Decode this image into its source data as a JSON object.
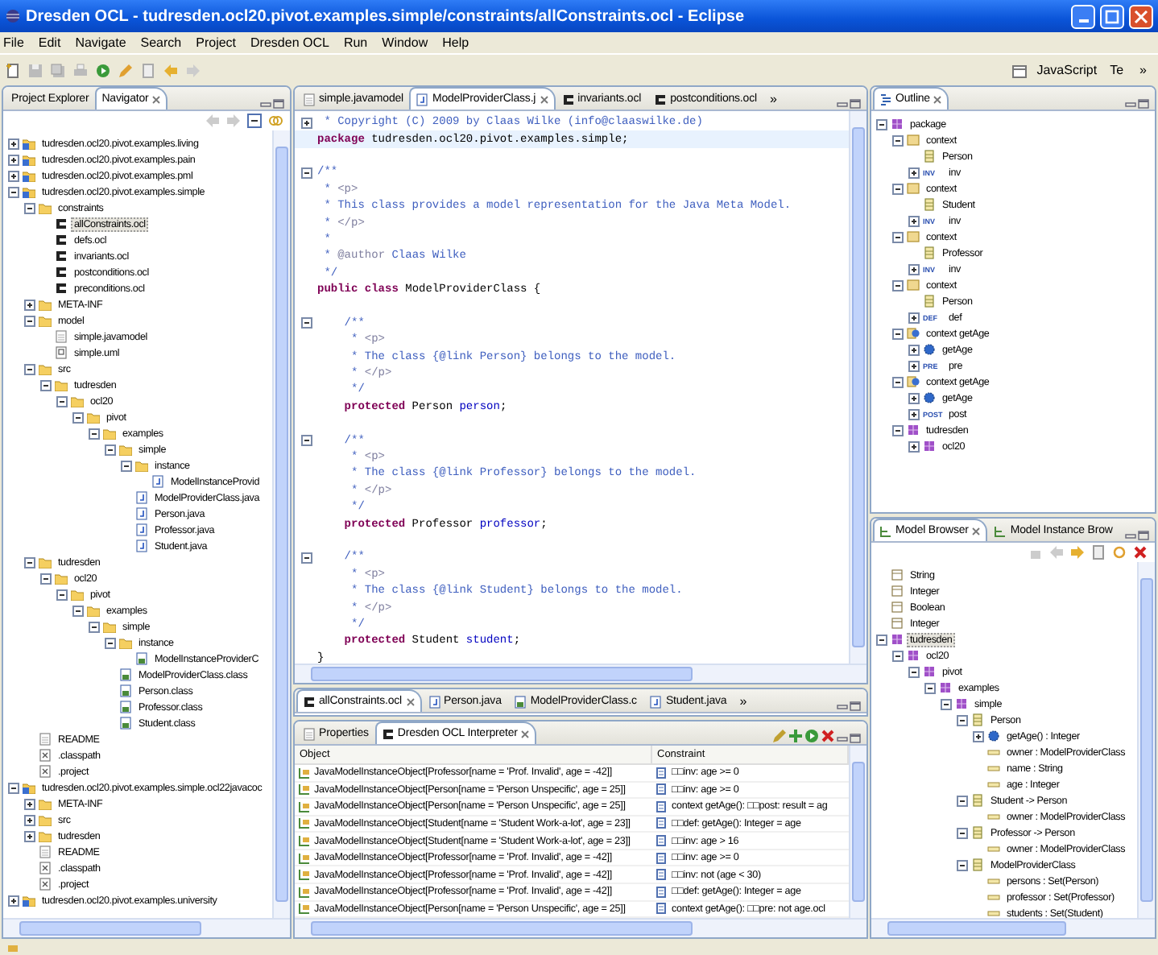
{
  "window": {
    "title": "Dresden OCL - tudresden.ocl20.pivot.examples.simple/constraints/allConstraints.ocl - Eclipse"
  },
  "menu": [
    "File",
    "Edit",
    "Navigate",
    "Search",
    "Project",
    "Dresden OCL",
    "Run",
    "Window",
    "Help"
  ],
  "toolbar": {
    "perspectives": [
      "JavaScript",
      "Te"
    ],
    "overflow": "»"
  },
  "navigator": {
    "tabs": [
      {
        "label": "Project Explorer",
        "selected": false
      },
      {
        "label": "Navigator",
        "selected": true
      }
    ],
    "tree": [
      {
        "label": "tudresden.ocl20.pivot.examples.living",
        "kind": "project",
        "expanded": false,
        "selected": false
      },
      {
        "label": "tudresden.ocl20.pivot.examples.pain",
        "kind": "project",
        "expanded": false,
        "selected": false
      },
      {
        "label": "tudresden.ocl20.pivot.examples.pml",
        "kind": "project",
        "expanded": false,
        "selected": false
      },
      {
        "label": "tudresden.ocl20.pivot.examples.simple",
        "kind": "project",
        "expanded": true,
        "selected": false,
        "children": [
          {
            "label": "constraints",
            "kind": "folder",
            "expanded": true,
            "selected": false,
            "children": [
              {
                "label": "allConstraints.ocl",
                "kind": "ocl",
                "selected": true
              },
              {
                "label": "defs.ocl",
                "kind": "ocl",
                "selected": false
              },
              {
                "label": "invariants.ocl",
                "kind": "ocl",
                "selected": false
              },
              {
                "label": "postconditions.ocl",
                "kind": "ocl",
                "selected": false
              },
              {
                "label": "preconditions.ocl",
                "kind": "ocl",
                "selected": false
              }
            ]
          },
          {
            "label": "META-INF",
            "kind": "folder",
            "expanded": false,
            "selected": false
          },
          {
            "label": "model",
            "kind": "folder",
            "expanded": true,
            "selected": false,
            "children": [
              {
                "label": "simple.javamodel",
                "kind": "file",
                "selected": false
              },
              {
                "label": "simple.uml",
                "kind": "uml",
                "selected": false
              }
            ]
          },
          {
            "label": "src",
            "kind": "folder",
            "expanded": true,
            "selected": false,
            "children": [
              {
                "label": "tudresden",
                "kind": "folder",
                "expanded": true,
                "selected": false,
                "children": [
                  {
                    "label": "ocl20",
                    "kind": "folder",
                    "expanded": true,
                    "selected": false,
                    "children": [
                      {
                        "label": "pivot",
                        "kind": "folder",
                        "expanded": true,
                        "selected": false,
                        "children": [
                          {
                            "label": "examples",
                            "kind": "folder",
                            "expanded": true,
                            "selected": false,
                            "children": [
                              {
                                "label": "simple",
                                "kind": "folder",
                                "expanded": true,
                                "selected": false,
                                "children": [
                                  {
                                    "label": "instance",
                                    "kind": "folder",
                                    "expanded": true,
                                    "selected": false,
                                    "children": [
                                      {
                                        "label": "ModelInstanceProvid",
                                        "kind": "java",
                                        "selected": false
                                      }
                                    ]
                                  },
                                  {
                                    "label": "ModelProviderClass.java",
                                    "kind": "java",
                                    "selected": false
                                  },
                                  {
                                    "label": "Person.java",
                                    "kind": "java",
                                    "selected": false
                                  },
                                  {
                                    "label": "Professor.java",
                                    "kind": "java",
                                    "selected": false
                                  },
                                  {
                                    "label": "Student.java",
                                    "kind": "java",
                                    "selected": false
                                  }
                                ]
                              }
                            ]
                          }
                        ]
                      }
                    ]
                  }
                ]
              }
            ]
          },
          {
            "label": "tudresden",
            "kind": "folder",
            "expanded": true,
            "selected": false,
            "children": [
              {
                "label": "ocl20",
                "kind": "folder",
                "expanded": true,
                "selected": false,
                "children": [
                  {
                    "label": "pivot",
                    "kind": "folder",
                    "expanded": true,
                    "selected": false,
                    "children": [
                      {
                        "label": "examples",
                        "kind": "folder",
                        "expanded": true,
                        "selected": false,
                        "children": [
                          {
                            "label": "simple",
                            "kind": "folder",
                            "expanded": true,
                            "selected": false,
                            "children": [
                              {
                                "label": "instance",
                                "kind": "folder",
                                "expanded": true,
                                "selected": false,
                                "children": [
                                  {
                                    "label": "ModelInstanceProviderC",
                                    "kind": "class",
                                    "selected": false
                                  }
                                ]
                              },
                              {
                                "label": "ModelProviderClass.class",
                                "kind": "class",
                                "selected": false
                              },
                              {
                                "label": "Person.class",
                                "kind": "class",
                                "selected": false
                              },
                              {
                                "label": "Professor.class",
                                "kind": "class",
                                "selected": false
                              },
                              {
                                "label": "Student.class",
                                "kind": "class",
                                "selected": false
                              }
                            ]
                          }
                        ]
                      }
                    ]
                  }
                ]
              }
            ]
          },
          {
            "label": "README",
            "kind": "file",
            "selected": false
          },
          {
            "label": ".classpath",
            "kind": "xml",
            "selected": false
          },
          {
            "label": ".project",
            "kind": "xml",
            "selected": false
          }
        ]
      },
      {
        "label": "tudresden.ocl20.pivot.examples.simple.ocl22javacoc",
        "kind": "project",
        "expanded": true,
        "selected": false,
        "children": [
          {
            "label": "META-INF",
            "kind": "folder",
            "expanded": false,
            "selected": false
          },
          {
            "label": "src",
            "kind": "folder",
            "expanded": false,
            "selected": false
          },
          {
            "label": "tudresden",
            "kind": "folder",
            "expanded": false,
            "selected": false
          },
          {
            "label": "README",
            "kind": "file",
            "selected": false
          },
          {
            "label": ".classpath",
            "kind": "xml",
            "selected": false
          },
          {
            "label": ".project",
            "kind": "xml",
            "selected": false
          }
        ]
      },
      {
        "label": "tudresden.ocl20.pivot.examples.university",
        "kind": "project",
        "expanded": false,
        "selected": false
      }
    ]
  },
  "editor": {
    "tabs": [
      {
        "label": "simple.javamodel",
        "kind": "file",
        "selected": false
      },
      {
        "label": "ModelProviderClass.j",
        "kind": "java",
        "selected": true
      },
      {
        "label": "invariants.ocl",
        "kind": "ocl",
        "selected": false
      },
      {
        "label": "postconditions.ocl",
        "kind": "ocl",
        "selected": false
      }
    ],
    "overflow": "»",
    "lines": [
      {
        "kind": "code",
        "folded": true,
        "segments": [
          {
            "kind": "comment",
            "text": " * Copyright (C) 2009 by Claas Wilke (info@claaswilke.de)"
          }
        ]
      },
      {
        "kind": "code",
        "current": true,
        "segments": [
          {
            "kind": "keyword",
            "text": "package"
          },
          {
            "kind": "plain",
            "text": " tudresden.ocl20.pivot.examples.simple;"
          }
        ]
      },
      {
        "kind": "blank"
      },
      {
        "kind": "code",
        "folded": false,
        "segments": [
          {
            "kind": "comment",
            "text": "/**"
          }
        ]
      },
      {
        "kind": "code",
        "segments": [
          {
            "kind": "comment",
            "text": " * "
          },
          {
            "kind": "tag",
            "text": "<p>"
          }
        ]
      },
      {
        "kind": "code",
        "segments": [
          {
            "kind": "comment",
            "text": " * This class provides a model representation for the Java Meta Model."
          }
        ]
      },
      {
        "kind": "code",
        "segments": [
          {
            "kind": "comment",
            "text": " * "
          },
          {
            "kind": "tag",
            "text": "</p>"
          }
        ]
      },
      {
        "kind": "code",
        "segments": [
          {
            "kind": "comment",
            "text": " *"
          }
        ]
      },
      {
        "kind": "code",
        "segments": [
          {
            "kind": "comment",
            "text": " * "
          },
          {
            "kind": "tag",
            "text": "@author"
          },
          {
            "kind": "comment",
            "text": " Claas Wilke"
          }
        ]
      },
      {
        "kind": "code",
        "segments": [
          {
            "kind": "comment",
            "text": " */"
          }
        ]
      },
      {
        "kind": "code",
        "segments": [
          {
            "kind": "keyword",
            "text": "public class"
          },
          {
            "kind": "plain",
            "text": " ModelProviderClass {"
          }
        ]
      },
      {
        "kind": "blank"
      },
      {
        "kind": "code",
        "folded": false,
        "segments": [
          {
            "kind": "comment",
            "text": "    /**"
          }
        ]
      },
      {
        "kind": "code",
        "segments": [
          {
            "kind": "comment",
            "text": "     * "
          },
          {
            "kind": "tag",
            "text": "<p>"
          }
        ]
      },
      {
        "kind": "code",
        "segments": [
          {
            "kind": "comment",
            "text": "     * The class {@link Person} belongs to the model."
          }
        ]
      },
      {
        "kind": "code",
        "segments": [
          {
            "kind": "comment",
            "text": "     * "
          },
          {
            "kind": "tag",
            "text": "</p>"
          }
        ]
      },
      {
        "kind": "code",
        "segments": [
          {
            "kind": "comment",
            "text": "     */"
          }
        ]
      },
      {
        "kind": "code",
        "segments": [
          {
            "kind": "keyword",
            "text": "    protected"
          },
          {
            "kind": "plain",
            "text": " Person "
          },
          {
            "kind": "field",
            "text": "person"
          },
          {
            "kind": "plain",
            "text": ";"
          }
        ]
      },
      {
        "kind": "blank"
      },
      {
        "kind": "code",
        "folded": false,
        "segments": [
          {
            "kind": "comment",
            "text": "    /**"
          }
        ]
      },
      {
        "kind": "code",
        "segments": [
          {
            "kind": "comment",
            "text": "     * "
          },
          {
            "kind": "tag",
            "text": "<p>"
          }
        ]
      },
      {
        "kind": "code",
        "segments": [
          {
            "kind": "comment",
            "text": "     * The class {@link Professor} belongs to the model."
          }
        ]
      },
      {
        "kind": "code",
        "segments": [
          {
            "kind": "comment",
            "text": "     * "
          },
          {
            "kind": "tag",
            "text": "</p>"
          }
        ]
      },
      {
        "kind": "code",
        "segments": [
          {
            "kind": "comment",
            "text": "     */"
          }
        ]
      },
      {
        "kind": "code",
        "segments": [
          {
            "kind": "keyword",
            "text": "    protected"
          },
          {
            "kind": "plain",
            "text": " Professor "
          },
          {
            "kind": "field",
            "text": "professor"
          },
          {
            "kind": "plain",
            "text": ";"
          }
        ]
      },
      {
        "kind": "blank"
      },
      {
        "kind": "code",
        "folded": false,
        "segments": [
          {
            "kind": "comment",
            "text": "    /**"
          }
        ]
      },
      {
        "kind": "code",
        "segments": [
          {
            "kind": "comment",
            "text": "     * "
          },
          {
            "kind": "tag",
            "text": "<p>"
          }
        ]
      },
      {
        "kind": "code",
        "segments": [
          {
            "kind": "comment",
            "text": "     * The class {@link Student} belongs to the model."
          }
        ]
      },
      {
        "kind": "code",
        "segments": [
          {
            "kind": "comment",
            "text": "     * "
          },
          {
            "kind": "tag",
            "text": "</p>"
          }
        ]
      },
      {
        "kind": "code",
        "segments": [
          {
            "kind": "comment",
            "text": "     */"
          }
        ]
      },
      {
        "kind": "code",
        "segments": [
          {
            "kind": "keyword",
            "text": "    protected"
          },
          {
            "kind": "plain",
            "text": " Student "
          },
          {
            "kind": "field",
            "text": "student"
          },
          {
            "kind": "plain",
            "text": ";"
          }
        ]
      },
      {
        "kind": "code",
        "segments": [
          {
            "kind": "plain",
            "text": "}"
          }
        ]
      }
    ]
  },
  "lower_editor": {
    "tabs": [
      {
        "label": "allConstraints.ocl",
        "kind": "ocl",
        "selected": true
      },
      {
        "label": "Person.java",
        "kind": "java",
        "selected": false
      },
      {
        "label": "ModelProviderClass.c",
        "kind": "class",
        "selected": false
      },
      {
        "label": "Student.java",
        "kind": "java",
        "selected": false
      }
    ],
    "overflow": "»"
  },
  "interpreter": {
    "tabs": [
      {
        "label": "Properties",
        "kind": "file",
        "selected": false
      },
      {
        "label": "Dresden OCL Interpreter",
        "kind": "ocl",
        "selected": true
      }
    ],
    "columns": [
      "Object",
      "Constraint"
    ],
    "rows": [
      {
        "object": "JavaModelInstanceObject[Professor[name = 'Prof. Invalid', age = -42]]",
        "constraint": "□□inv: age >= 0"
      },
      {
        "object": "JavaModelInstanceObject[Person[name = 'Person Unspecific', age = 25]]",
        "constraint": "□□inv: age >= 0"
      },
      {
        "object": "JavaModelInstanceObject[Person[name = 'Person Unspecific', age = 25]]",
        "constraint": "context getAge(): □□post: result = ag"
      },
      {
        "object": "JavaModelInstanceObject[Student[name = 'Student Work-a-lot', age = 23]]",
        "constraint": "□□def: getAge(): Integer = age"
      },
      {
        "object": "JavaModelInstanceObject[Student[name = 'Student Work-a-lot', age = 23]]",
        "constraint": "□□inv: age > 16"
      },
      {
        "object": "JavaModelInstanceObject[Professor[name = 'Prof. Invalid', age = -42]]",
        "constraint": "□□inv: age >= 0"
      },
      {
        "object": "JavaModelInstanceObject[Professor[name = 'Prof. Invalid', age = -42]]",
        "constraint": "□□inv: not (age < 30)"
      },
      {
        "object": "JavaModelInstanceObject[Professor[name = 'Prof. Invalid', age = -42]]",
        "constraint": "□□def: getAge(): Integer = age"
      },
      {
        "object": "JavaModelInstanceObject[Person[name = 'Person Unspecific', age = 25]]",
        "constraint": "context getAge(): □□pre: not age.ocl"
      }
    ]
  },
  "outline": {
    "tabs": [
      {
        "label": "Outline",
        "kind": "outline",
        "selected": true
      }
    ],
    "tree": [
      {
        "label": "package",
        "kind": "package",
        "expanded": true,
        "selected": false,
        "children": [
          {
            "label": "context",
            "kind": "context",
            "expanded": true,
            "selected": false,
            "children": [
              {
                "label": "Person",
                "kind": "classifier",
                "selected": false
              },
              {
                "label": "inv",
                "kind": "constraint",
                "badge": "INV",
                "expanded": false,
                "selected": false
              }
            ]
          },
          {
            "label": "context",
            "kind": "context",
            "expanded": true,
            "selected": false,
            "children": [
              {
                "label": "Student",
                "kind": "classifier",
                "selected": false
              },
              {
                "label": "inv",
                "kind": "constraint",
                "badge": "INV",
                "expanded": false,
                "selected": false
              }
            ]
          },
          {
            "label": "context",
            "kind": "context",
            "expanded": true,
            "selected": false,
            "children": [
              {
                "label": "Professor",
                "kind": "classifier",
                "selected": false
              },
              {
                "label": "inv",
                "kind": "constraint",
                "badge": "INV",
                "expanded": false,
                "selected": false
              }
            ]
          },
          {
            "label": "context",
            "kind": "context",
            "expanded": true,
            "selected": false,
            "children": [
              {
                "label": "Person",
                "kind": "classifier",
                "selected": false
              },
              {
                "label": "def",
                "kind": "constraint",
                "badge": "DEF",
                "expanded": false,
                "selected": false
              }
            ]
          },
          {
            "label": "context getAge",
            "kind": "operation-context",
            "expanded": true,
            "selected": false,
            "children": [
              {
                "label": "getAge",
                "kind": "operation",
                "expanded": false,
                "selected": false
              },
              {
                "label": "pre",
                "kind": "constraint",
                "badge": "PRE",
                "expanded": false,
                "selected": false
              }
            ]
          },
          {
            "label": "context getAge",
            "kind": "operation-context",
            "expanded": true,
            "selected": false,
            "children": [
              {
                "label": "getAge",
                "kind": "operation",
                "expanded": false,
                "selected": false
              },
              {
                "label": "post",
                "kind": "constraint",
                "badge": "POST",
                "expanded": false,
                "selected": false
              }
            ]
          },
          {
            "label": "tudresden",
            "kind": "package",
            "expanded": true,
            "selected": false,
            "children": [
              {
                "label": "ocl20",
                "kind": "package",
                "expanded": false,
                "selected": false
              }
            ]
          }
        ]
      }
    ]
  },
  "model_browser": {
    "tabs": [
      {
        "label": "Model Browser",
        "kind": "browser",
        "selected": true
      },
      {
        "label": "Model Instance Brow",
        "kind": "browser",
        "selected": false
      }
    ],
    "tree": [
      {
        "label": "String",
        "kind": "datatype",
        "selected": false
      },
      {
        "label": "Integer",
        "kind": "datatype",
        "selected": false
      },
      {
        "label": "Boolean",
        "kind": "datatype",
        "selected": false
      },
      {
        "label": "Integer",
        "kind": "datatype",
        "selected": false
      },
      {
        "label": "tudresden",
        "kind": "package",
        "expanded": true,
        "selected": true,
        "children": [
          {
            "label": "ocl20",
            "kind": "package",
            "expanded": true,
            "selected": false,
            "children": [
              {
                "label": "pivot",
                "kind": "package",
                "expanded": true,
                "selected": false,
                "children": [
                  {
                    "label": "examples",
                    "kind": "package",
                    "expanded": true,
                    "selected": false,
                    "children": [
                      {
                        "label": "simple",
                        "kind": "package",
                        "expanded": true,
                        "selected": false,
                        "children": [
                          {
                            "label": "Person",
                            "kind": "classifier",
                            "expanded": true,
                            "selected": false,
                            "children": [
                              {
                                "label": "getAge() : Integer",
                                "kind": "operation",
                                "expanded": false,
                                "selected": false
                              },
                              {
                                "label": "owner : ModelProviderClass",
                                "kind": "attribute",
                                "selected": false
                              },
                              {
                                "label": "name : String",
                                "kind": "attribute",
                                "selected": false
                              },
                              {
                                "label": "age : Integer",
                                "kind": "attribute",
                                "selected": false
                              }
                            ]
                          },
                          {
                            "label": "Student -> Person",
                            "kind": "classifier",
                            "expanded": true,
                            "selected": false,
                            "children": [
                              {
                                "label": "owner : ModelProviderClass",
                                "kind": "attribute",
                                "selected": false
                              }
                            ]
                          },
                          {
                            "label": "Professor -> Person",
                            "kind": "classifier",
                            "expanded": true,
                            "selected": false,
                            "children": [
                              {
                                "label": "owner : ModelProviderClass",
                                "kind": "attribute",
                                "selected": false
                              }
                            ]
                          },
                          {
                            "label": "ModelProviderClass",
                            "kind": "classifier",
                            "expanded": true,
                            "selected": false,
                            "children": [
                              {
                                "label": "persons : Set(Person)",
                                "kind": "attribute",
                                "selected": false
                              },
                              {
                                "label": "professor : Set(Professor)",
                                "kind": "attribute",
                                "selected": false
                              },
                              {
                                "label": "students : Set(Student)",
                                "kind": "attribute",
                                "selected": false
                              }
                            ]
                          }
                        ]
                      }
                    ]
                  }
                ]
              }
            ]
          }
        ]
      }
    ]
  }
}
